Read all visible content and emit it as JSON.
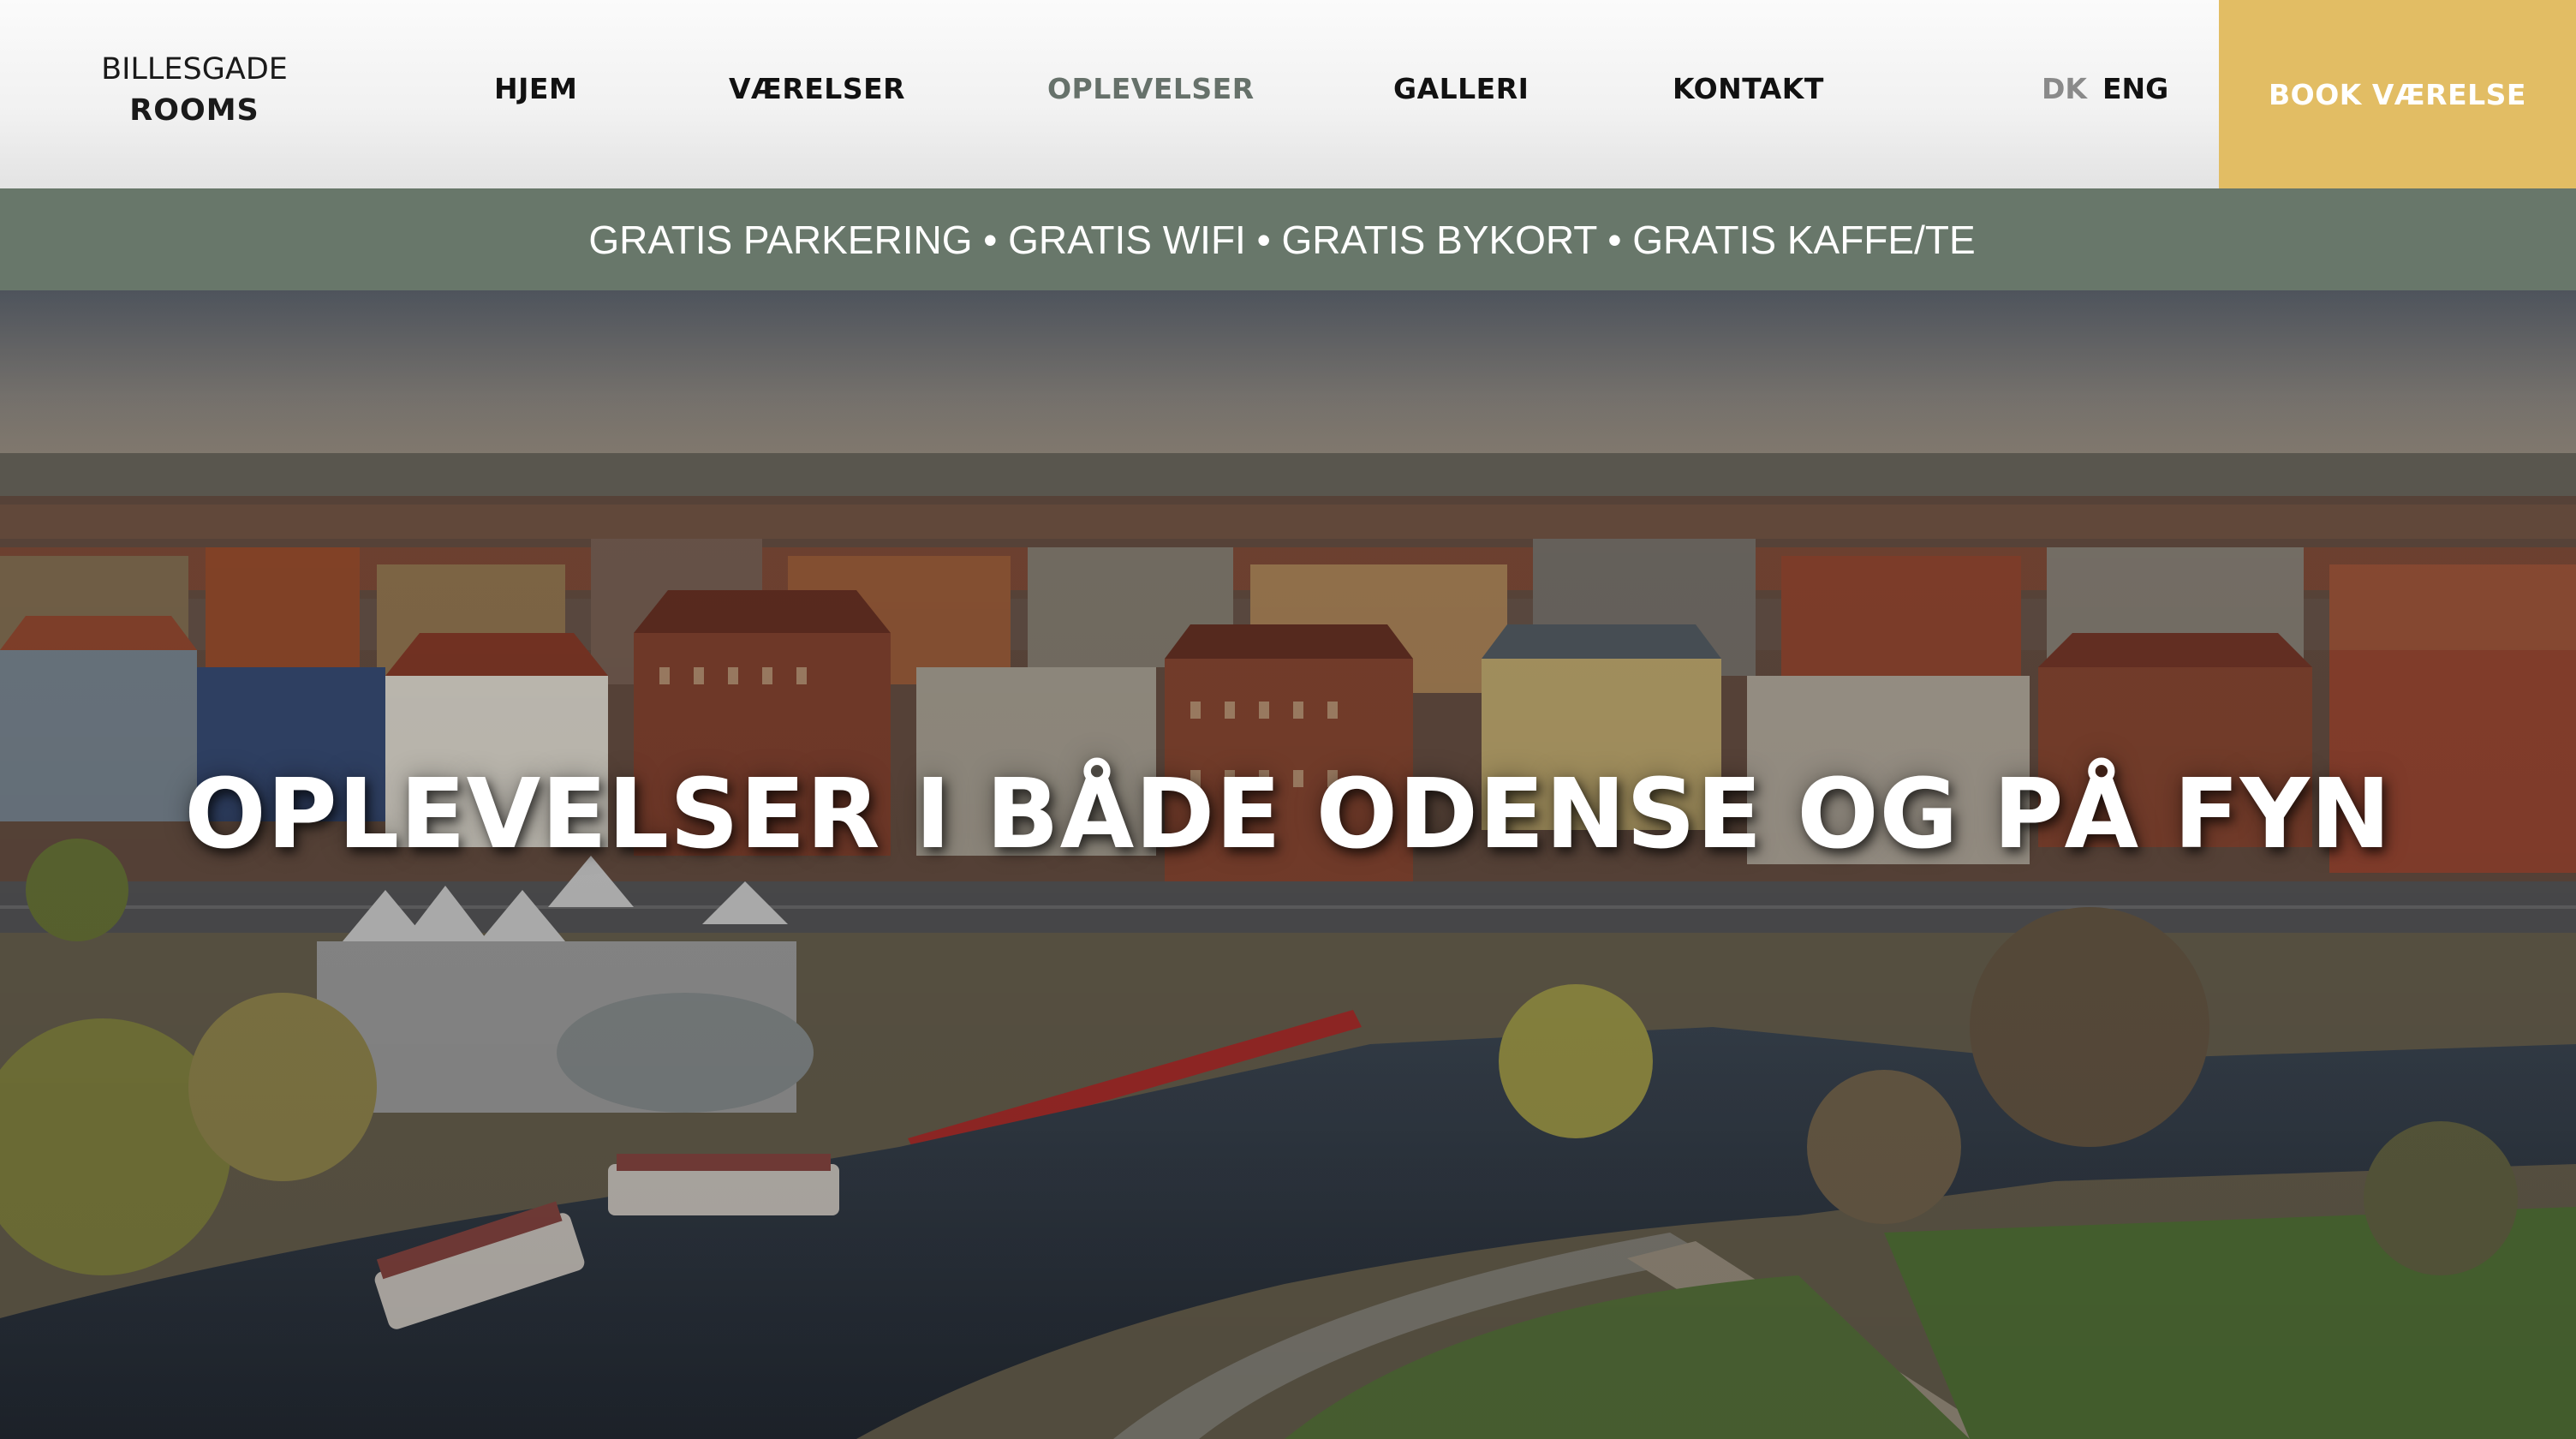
{
  "brand": {
    "line1": "BILLESGADE",
    "line2": "ROOMS"
  },
  "nav": {
    "items": [
      {
        "label": "HJEM",
        "active": false
      },
      {
        "label": "VÆRELSER",
        "active": false
      },
      {
        "label": "OPLEVELSER",
        "active": true
      },
      {
        "label": "GALLERI",
        "active": false
      },
      {
        "label": "KONTAKT",
        "active": false
      }
    ]
  },
  "language": {
    "dk": "DK",
    "eng": "ENG"
  },
  "book_button": {
    "label": "BOOK VÆRELSE"
  },
  "perks": {
    "text": "GRATIS PARKERING • GRATIS WIFI • GRATIS BYKORT • GRATIS KAFFE/TE"
  },
  "hero": {
    "title": "OPLEVELSER I BÅDE ODENSE OG PÅ FYN"
  },
  "colors": {
    "accent_gold": "#e2bd64",
    "banner_green": "#68776a",
    "active_nav": "#66716a"
  }
}
